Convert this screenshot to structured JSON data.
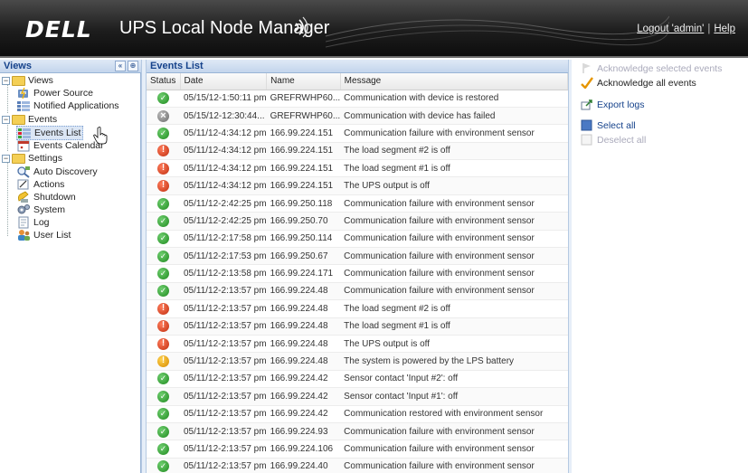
{
  "header": {
    "brand": "DELL",
    "title": "UPS Local Node Manager",
    "logout": "Logout 'admin'",
    "separator": "|",
    "help": "Help"
  },
  "left_panel": {
    "title": "Views",
    "tree": [
      {
        "label": "Views",
        "level": 0,
        "kind": "folder"
      },
      {
        "label": "Power Source",
        "level": 1,
        "kind": "power-source"
      },
      {
        "label": "Notified Applications",
        "level": 1,
        "kind": "apps"
      },
      {
        "label": "Events",
        "level": 0,
        "kind": "folder"
      },
      {
        "label": "Events List",
        "level": 1,
        "kind": "events-list",
        "selected": true
      },
      {
        "label": "Events Calendar",
        "level": 1,
        "kind": "calendar"
      },
      {
        "label": "Settings",
        "level": 0,
        "kind": "folder"
      },
      {
        "label": "Auto Discovery",
        "level": 1,
        "kind": "discovery"
      },
      {
        "label": "Actions",
        "level": 1,
        "kind": "actions"
      },
      {
        "label": "Shutdown",
        "level": 1,
        "kind": "shutdown"
      },
      {
        "label": "System",
        "level": 1,
        "kind": "system"
      },
      {
        "label": "Log",
        "level": 1,
        "kind": "log"
      },
      {
        "label": "User List",
        "level": 1,
        "kind": "users"
      }
    ]
  },
  "events_panel": {
    "title": "Events List",
    "columns": [
      "Status",
      "Date",
      "Name",
      "Message"
    ],
    "rows": [
      {
        "status": "ok",
        "date": "05/15/12-1:50:11 pm",
        "name": "GREFRWHP60...",
        "message": "Communication with device is restored"
      },
      {
        "status": "gray",
        "date": "05/15/12-12:30:44...",
        "name": "GREFRWHP60...",
        "message": "Communication with device has failed"
      },
      {
        "status": "ok",
        "date": "05/11/12-4:34:12 pm",
        "name": "166.99.224.151",
        "message": "Communication failure with environment sensor"
      },
      {
        "status": "crit",
        "date": "05/11/12-4:34:12 pm",
        "name": "166.99.224.151",
        "message": "The load segment #2 is off"
      },
      {
        "status": "crit",
        "date": "05/11/12-4:34:12 pm",
        "name": "166.99.224.151",
        "message": "The load segment #1 is off"
      },
      {
        "status": "crit",
        "date": "05/11/12-4:34:12 pm",
        "name": "166.99.224.151",
        "message": "The UPS output is off"
      },
      {
        "status": "ok",
        "date": "05/11/12-2:42:25 pm",
        "name": "166.99.250.118",
        "message": "Communication failure with environment sensor"
      },
      {
        "status": "ok",
        "date": "05/11/12-2:42:25 pm",
        "name": "166.99.250.70",
        "message": "Communication failure with environment sensor"
      },
      {
        "status": "ok",
        "date": "05/11/12-2:17:58 pm",
        "name": "166.99.250.114",
        "message": "Communication failure with environment sensor"
      },
      {
        "status": "ok",
        "date": "05/11/12-2:17:53 pm",
        "name": "166.99.250.67",
        "message": "Communication failure with environment sensor"
      },
      {
        "status": "ok",
        "date": "05/11/12-2:13:58 pm",
        "name": "166.99.224.171",
        "message": "Communication failure with environment sensor"
      },
      {
        "status": "ok",
        "date": "05/11/12-2:13:57 pm",
        "name": "166.99.224.48",
        "message": "Communication failure with environment sensor"
      },
      {
        "status": "crit",
        "date": "05/11/12-2:13:57 pm",
        "name": "166.99.224.48",
        "message": "The load segment #2 is off"
      },
      {
        "status": "crit",
        "date": "05/11/12-2:13:57 pm",
        "name": "166.99.224.48",
        "message": "The load segment #1 is off"
      },
      {
        "status": "crit",
        "date": "05/11/12-2:13:57 pm",
        "name": "166.99.224.48",
        "message": "The UPS output is off"
      },
      {
        "status": "warn",
        "date": "05/11/12-2:13:57 pm",
        "name": "166.99.224.48",
        "message": "The system is powered by the LPS battery"
      },
      {
        "status": "ok",
        "date": "05/11/12-2:13:57 pm",
        "name": "166.99.224.42",
        "message": "Sensor contact 'Input #2': off"
      },
      {
        "status": "ok",
        "date": "05/11/12-2:13:57 pm",
        "name": "166.99.224.42",
        "message": "Sensor contact 'Input #1': off"
      },
      {
        "status": "ok",
        "date": "05/11/12-2:13:57 pm",
        "name": "166.99.224.42",
        "message": "Communication restored with environment sensor"
      },
      {
        "status": "ok",
        "date": "05/11/12-2:13:57 pm",
        "name": "166.99.224.93",
        "message": "Communication failure with environment sensor"
      },
      {
        "status": "ok",
        "date": "05/11/12-2:13:57 pm",
        "name": "166.99.224.106",
        "message": "Communication failure with environment sensor"
      },
      {
        "status": "ok",
        "date": "05/11/12-2:13:57 pm",
        "name": "166.99.224.40",
        "message": "Communication failure with environment sensor"
      }
    ]
  },
  "actions_panel": {
    "items": [
      {
        "label": "Acknowledge selected events",
        "enabled": false,
        "icon": "flag-icon"
      },
      {
        "label": "Acknowledge all events",
        "enabled": true,
        "icon": "checkmark-icon"
      },
      {
        "label": "Export logs",
        "enabled": true,
        "icon": "export-icon"
      },
      {
        "label": "Select all",
        "enabled": true,
        "icon": "select-all-icon"
      },
      {
        "label": "Deselect all",
        "enabled": false,
        "icon": "deselect-icon"
      }
    ]
  },
  "colors": {
    "header_bg": "#1d1d1d",
    "panel_title": "#15428b",
    "status_ok": "#1f8a1f",
    "status_critical": "#c02f10",
    "status_warning": "#d68a00",
    "status_unknown": "#6a6a6a"
  }
}
